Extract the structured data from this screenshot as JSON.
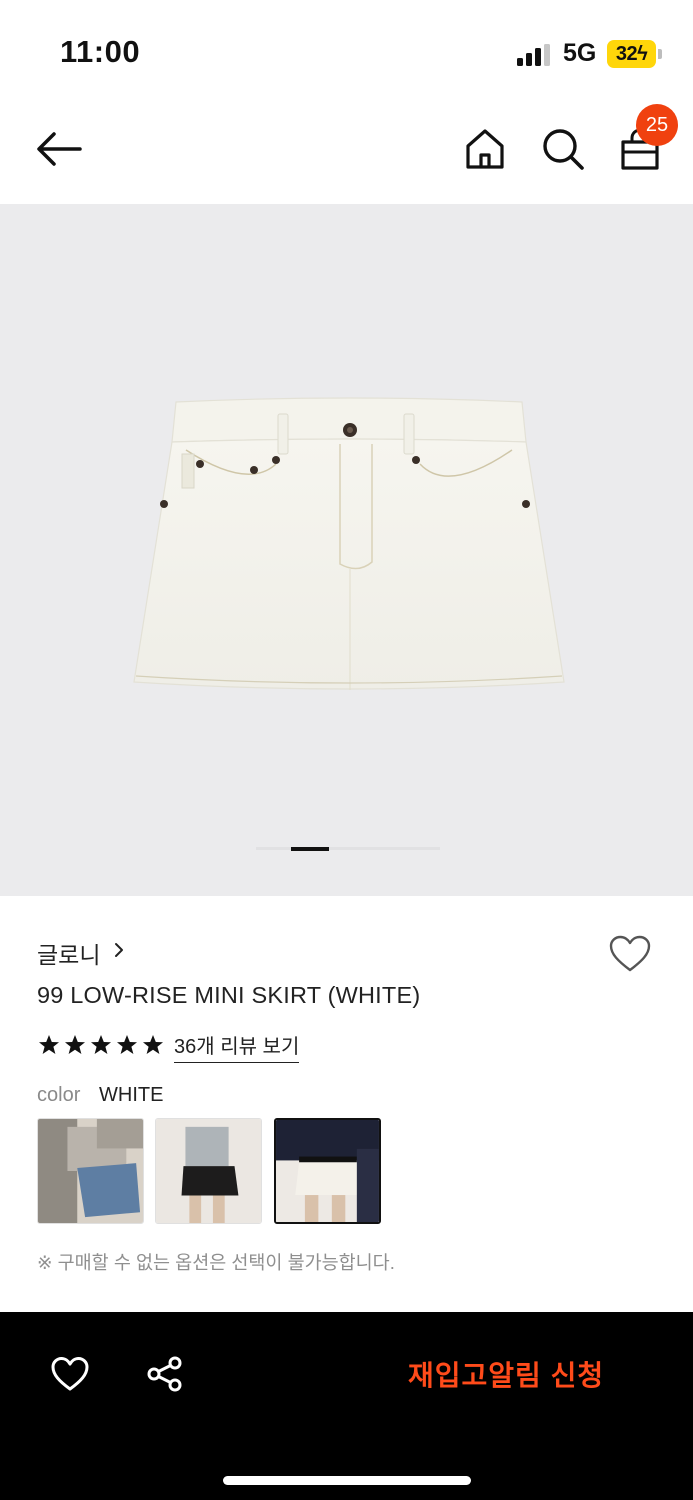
{
  "status_bar": {
    "time": "11:00",
    "network": "5G",
    "battery": "32",
    "icons": [
      "signal-icon",
      "battery-charging-icon"
    ]
  },
  "nav": {
    "icons": [
      "back-arrow-icon",
      "home-icon",
      "search-icon",
      "shopping-bag-icon"
    ],
    "cart_count": "25"
  },
  "gallery": {
    "current_slide": 1
  },
  "product": {
    "brand": "글로니",
    "name": "99 LOW-RISE MINI SKIRT (WHITE)",
    "rating_stars": 5,
    "review_link": "36개 리뷰 보기",
    "color_label": "color",
    "color_value": "WHITE",
    "swatches": [
      "denim-blue",
      "black",
      "white"
    ],
    "selected_swatch": 3,
    "notice": "※ 구매할 수 없는 옵션은 선택이 불가능합니다."
  },
  "bottom_bar": {
    "icons": [
      "heart-icon",
      "share-icon"
    ],
    "cta_label": "재입고알림 신청"
  },
  "colors": {
    "accent": "#f0410f",
    "cta": "#ff4b1a",
    "image_bg": "#ebebed",
    "bottom_bar_bg": "#000000"
  }
}
